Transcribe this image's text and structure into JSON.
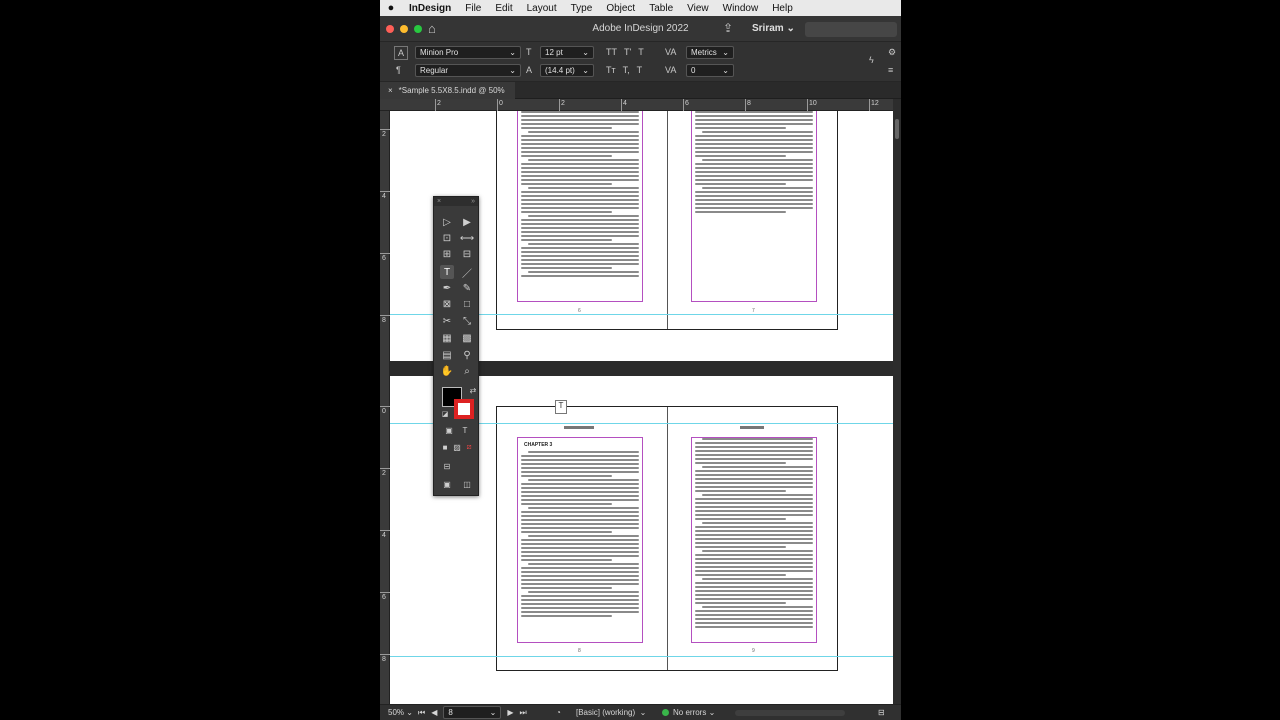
{
  "menubar": {
    "apple": "",
    "app_name": "InDesign",
    "items": [
      "File",
      "Edit",
      "Layout",
      "Type",
      "Object",
      "Table",
      "View",
      "Window",
      "Help"
    ]
  },
  "titlebar": {
    "title": "Adobe InDesign 2022",
    "user": "Sriram",
    "user_chevron": "⌄"
  },
  "control_panel": {
    "font_family": "Minion Pro",
    "font_style": "Regular",
    "font_size": "12 pt",
    "leading": "(14.4 pt)",
    "kerning": "Metrics",
    "tracking": "0"
  },
  "document_tab": {
    "close": "×",
    "label": "*Sample 5.5X8.5.indd @ 50%"
  },
  "ruler": {
    "h_labels": [
      "2",
      "0",
      "2",
      "4",
      "6",
      "8",
      "10",
      "12"
    ],
    "v_labels": [
      "2",
      "4",
      "6",
      "8",
      "0",
      "2",
      "4",
      "6",
      "8"
    ]
  },
  "document": {
    "chapter_heading": "CHAPTER 3"
  },
  "status": {
    "zoom": "50%",
    "page": "8",
    "style": "[Basic] (working)",
    "preflight": "No errors"
  },
  "colors": {
    "accent_guide": "#6fd6e8",
    "frame_edge": "#b44fc0",
    "ok_status": "#39b54a"
  },
  "icons": [
    "apple-icon",
    "home-icon",
    "share-icon",
    "close-icon",
    "selection-tool-icon",
    "direct-selection-tool-icon",
    "page-tool-icon",
    "gap-tool-icon",
    "content-collector-icon",
    "content-placer-icon",
    "type-tool-icon",
    "line-tool-icon",
    "pen-tool-icon",
    "pencil-tool-icon",
    "rectangle-frame-tool-icon",
    "rectangle-tool-icon",
    "scissors-tool-icon",
    "free-transform-tool-icon",
    "gradient-swatch-tool-icon",
    "gradient-feather-tool-icon",
    "note-tool-icon",
    "eyedropper-tool-icon",
    "hand-tool-icon",
    "zoom-tool-icon"
  ]
}
